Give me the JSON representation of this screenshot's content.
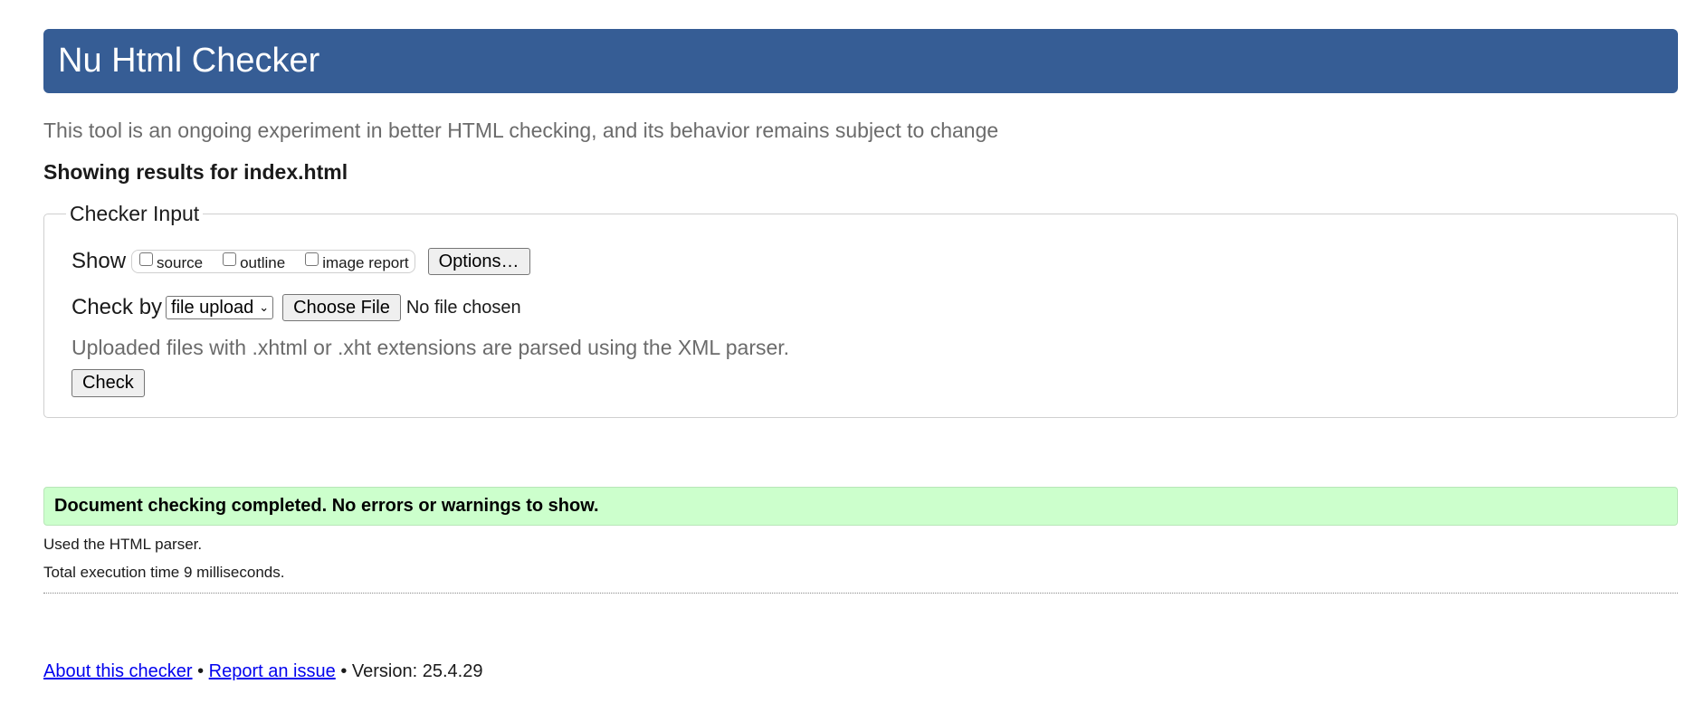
{
  "header": {
    "title": "Nu Html Checker",
    "brand_color": "#365d95"
  },
  "tagline": "This tool is an ongoing experiment in better HTML checking, and its behavior remains subject to change",
  "showing_results": "Showing results for index.html",
  "checker_input": {
    "legend": "Checker Input",
    "show_label": "Show",
    "show_options": [
      {
        "label": "source",
        "checked": false
      },
      {
        "label": "outline",
        "checked": false
      },
      {
        "label": "image report",
        "checked": false
      }
    ],
    "options_button": "Options…",
    "check_by_label": "Check by",
    "check_by_selected": "file upload",
    "choose_file_button": "Choose File",
    "no_file_text": "No file chosen",
    "hint": "Uploaded files with .xhtml or .xht extensions are parsed using the XML parser.",
    "check_button": "Check"
  },
  "result": {
    "message": "Document checking completed. No errors or warnings to show.",
    "success_color": "#ccffcc",
    "parser_note": "Used the HTML parser.",
    "execution_time": "Total execution time 9 milliseconds."
  },
  "footer": {
    "about_link": "About this checker",
    "separator": "•",
    "report_link": "Report an issue",
    "version": "Version: 25.4.29"
  }
}
